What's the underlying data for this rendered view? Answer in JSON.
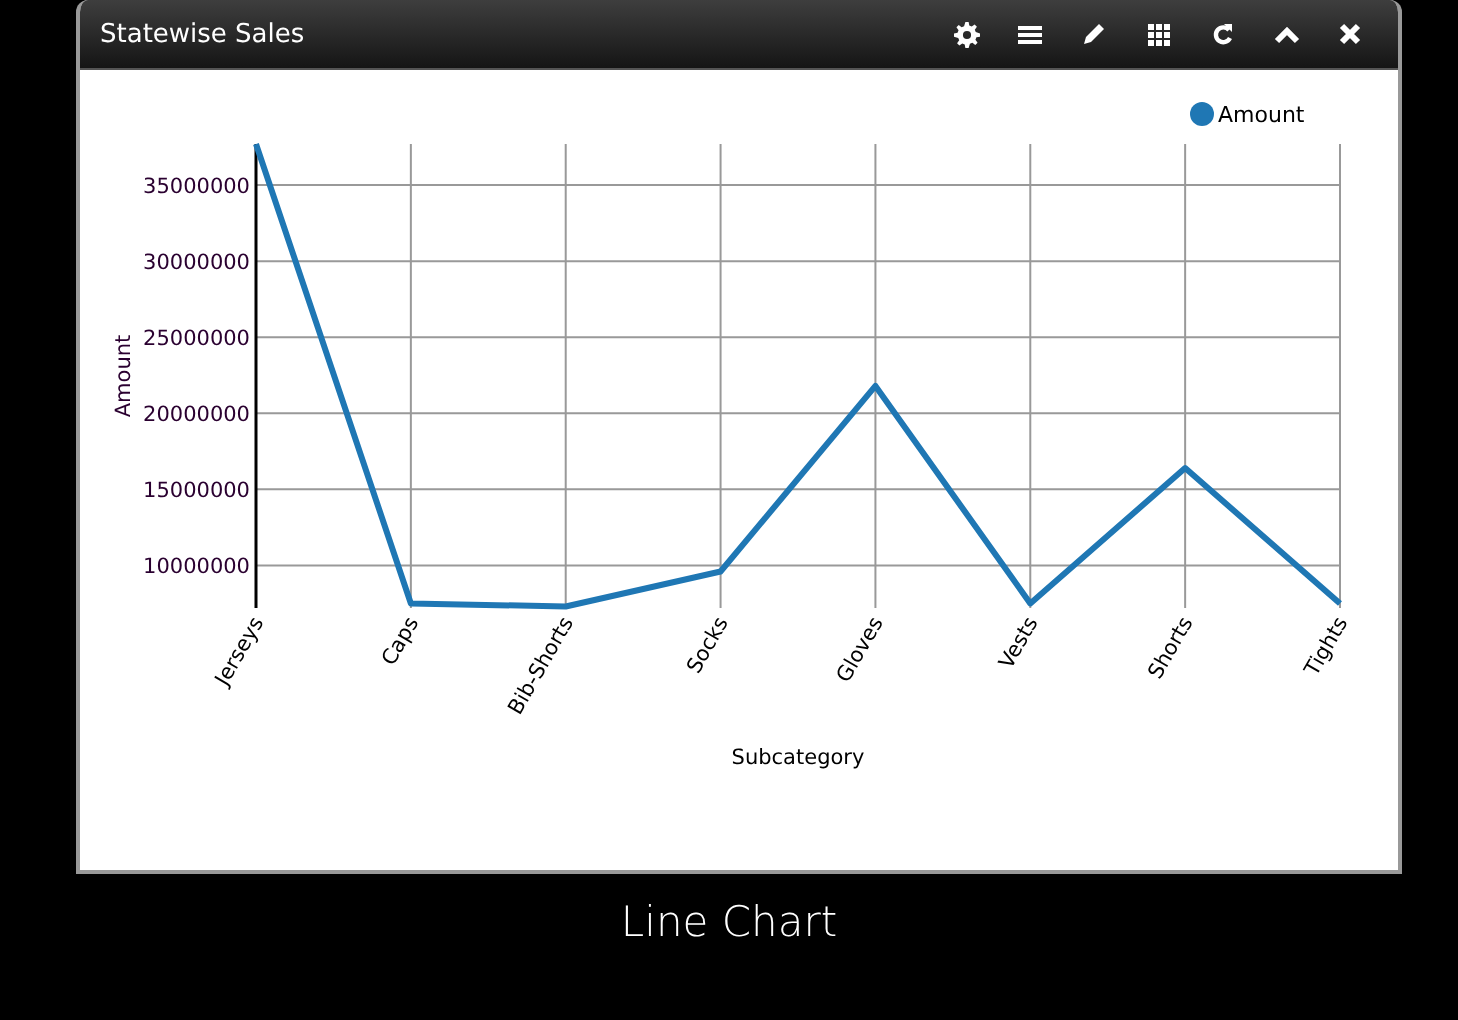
{
  "widget": {
    "title": "Statewise Sales",
    "toolbar": [
      {
        "kind": "settings"
      },
      {
        "kind": "menu"
      },
      {
        "kind": "edit"
      },
      {
        "kind": "grid"
      },
      {
        "kind": "refresh"
      },
      {
        "kind": "collapse"
      },
      {
        "kind": "close"
      }
    ],
    "chart_data": {
      "type": "line",
      "xlabel": "Subcategory",
      "ylabel": "Amount",
      "categories": [
        "Jerseys",
        "Caps",
        "Bib-Shorts",
        "Socks",
        "Gloves",
        "Vests",
        "Shorts",
        "Tights"
      ],
      "series": [
        {
          "name": "Amount",
          "color": "#1f77b4",
          "values": [
            37700000,
            7500000,
            7300000,
            9600000,
            21800000,
            7500000,
            16400000,
            7500000
          ]
        }
      ],
      "grid": true,
      "ylim": [
        7200000,
        37700000
      ],
      "yticks": [
        10000000,
        15000000,
        20000000,
        25000000,
        30000000,
        35000000
      ]
    }
  },
  "caption": "Line Chart"
}
